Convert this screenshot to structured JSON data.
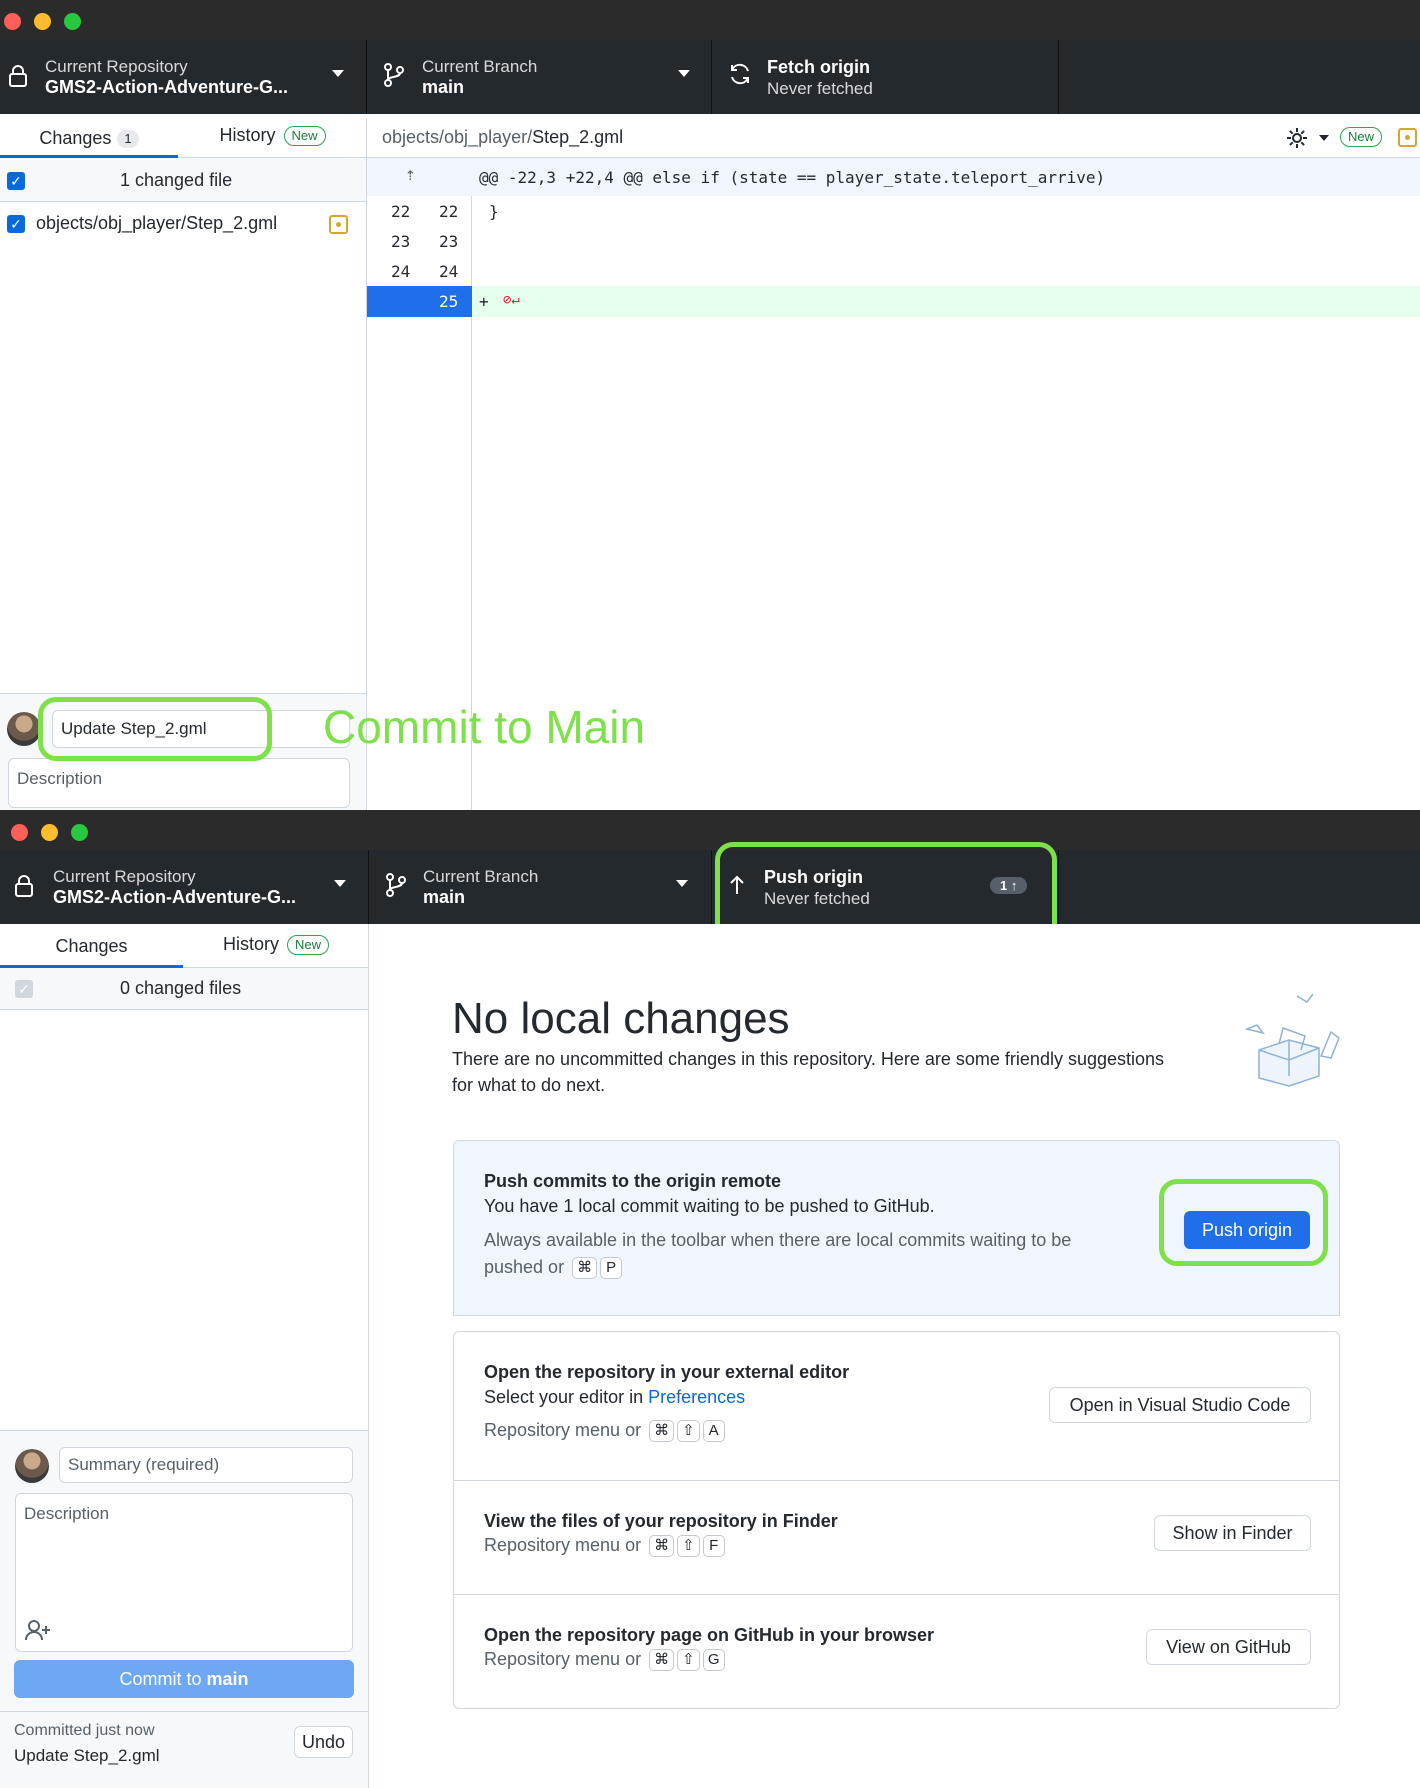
{
  "top_window": {
    "repo": {
      "label": "Current Repository",
      "name": "GMS2-Action-Adventure-G..."
    },
    "branch": {
      "label": "Current Branch",
      "name": "main"
    },
    "fetch": {
      "title": "Fetch origin",
      "subtitle": "Never fetched"
    },
    "tabs": {
      "changes": "Changes",
      "changes_count": "1",
      "history": "History",
      "history_badge": "New"
    },
    "changed_files_summary": "1 changed file",
    "file": "objects/obj_player/Step_2.gml",
    "diff": {
      "path_prefix": "objects/obj_player/",
      "path_file": "Step_2.gml",
      "new_badge": "New",
      "hunk_header": "@@ -22,3 +22,4 @@ else if (state == player_state.teleport_arrive)",
      "lines": [
        {
          "old": "22",
          "new": "22",
          "text": "}"
        },
        {
          "old": "23",
          "new": "23",
          "text": ""
        },
        {
          "old": "24",
          "new": "24",
          "text": ""
        },
        {
          "old": "",
          "new": "25",
          "text": "+"
        }
      ]
    },
    "summary_value": "Update Step_2.gml",
    "description_placeholder": "Description",
    "annotation": "Commit to Main"
  },
  "bottom_window": {
    "repo": {
      "label": "Current Repository",
      "name": "GMS2-Action-Adventure-G..."
    },
    "branch": {
      "label": "Current Branch",
      "name": "main"
    },
    "push": {
      "title": "Push origin",
      "subtitle": "Never fetched",
      "count": "1 ↑"
    },
    "tabs": {
      "changes": "Changes",
      "history": "History",
      "history_badge": "New"
    },
    "changed_files_summary": "0 changed files",
    "summary_placeholder": "Summary (required)",
    "description_placeholder": "Description",
    "commit_button": {
      "prefix": "Commit to ",
      "branch": "main"
    },
    "last_commit": {
      "when": "Committed just now",
      "message": "Update Step_2.gml",
      "undo": "Undo"
    },
    "main": {
      "heading": "No local changes",
      "intro_1": "There are no uncommitted changes in this repository. Here are some friendly suggestions",
      "intro_2": "for what to do next.",
      "push_card": {
        "title": "Push commits to the origin remote",
        "text": "You have 1 local commit waiting to be pushed to GitHub.",
        "hint_1": "Always available in the toolbar when there are local commits waiting to be",
        "hint_2": "pushed or",
        "keys": [
          "⌘",
          "P"
        ],
        "button": "Push origin"
      },
      "editor_card": {
        "title": "Open the repository in your external editor",
        "text_prefix": "Select your editor in ",
        "link": "Preferences",
        "hint": "Repository menu or",
        "keys": [
          "⌘",
          "⇧",
          "A"
        ],
        "button": "Open in Visual Studio Code"
      },
      "finder_card": {
        "title": "View the files of your repository in Finder",
        "hint": "Repository menu or",
        "keys": [
          "⌘",
          "⇧",
          "F"
        ],
        "button": "Show in Finder"
      },
      "github_card": {
        "title": "Open the repository page on GitHub in your browser",
        "hint": "Repository menu or",
        "keys": [
          "⌘",
          "⇧",
          "G"
        ],
        "button": "View on GitHub"
      }
    }
  },
  "colors": {
    "toolbar_bg": "#24292e",
    "accent_blue": "#0969da",
    "highlight_green": "#7ee04a",
    "added_line_bg": "#e6ffec"
  }
}
